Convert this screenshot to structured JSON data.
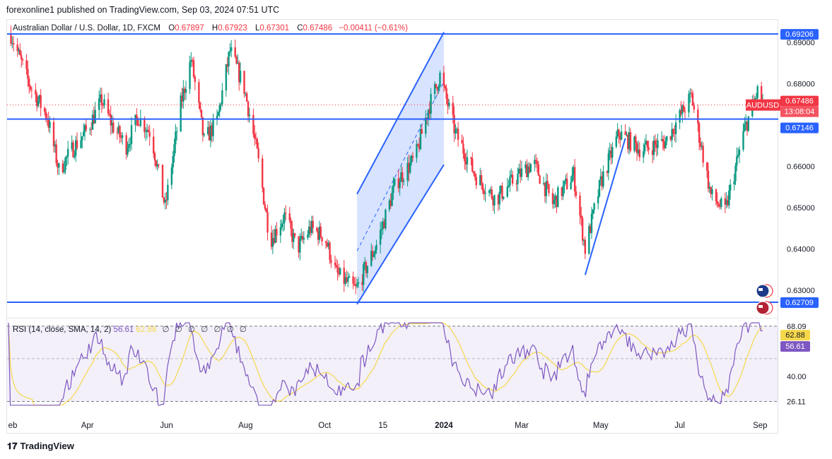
{
  "header": {
    "publish_line": "forexonline1 published on TradingView.com, Sep 03, 2024 07:51 UTC"
  },
  "legend": {
    "symbol": "Australian Dollar / U.S. Dollar, 1D, FXCM",
    "o_label": "O",
    "o_value": "0.67897",
    "h_label": "H",
    "h_value": "0.67923",
    "l_label": "L",
    "l_value": "0.67301",
    "c_label": "C",
    "c_value": "0.67486",
    "change": "−0.00411 (−0.61%)"
  },
  "rsi_legend": {
    "label": "RSI (14, close, SMA, 14, 2)",
    "rsi_value": "56.61",
    "ma_value": "62.88",
    "placeholders": [
      "∅",
      "∅",
      "∅",
      "∅",
      "∅",
      "∅",
      "∅"
    ]
  },
  "price_axis": {
    "ticks": [
      "0.69000",
      "0.68000",
      "0.66000",
      "0.65000",
      "0.64000",
      "0.63000"
    ],
    "labels": [
      {
        "text": "0.69206",
        "value": 0.69206,
        "color": "#2962ff"
      },
      {
        "text": "0.67486",
        "value": 0.67486,
        "color": "#f23645"
      },
      {
        "text": "AUDUSD",
        "value": 0.67486,
        "color": "#f23645"
      },
      {
        "text": "13:08:04",
        "value": 0.67486,
        "color": "#f23645"
      },
      {
        "text": "0.67146",
        "value": 0.67146,
        "color": "#2962ff"
      },
      {
        "text": "0.62709",
        "value": 0.62709,
        "color": "#2962ff"
      }
    ]
  },
  "rsi_axis": {
    "ticks": [
      "68.09",
      "40.00",
      "26.11"
    ],
    "labels": [
      {
        "text": "62.88",
        "value": 62.88,
        "color": "#f6d84b"
      },
      {
        "text": "56.61",
        "value": 56.61,
        "color": "#7e57c2"
      }
    ]
  },
  "time_axis": [
    "eb",
    "Apr",
    "Jun",
    "Aug",
    "Oct",
    "15",
    "2024",
    "Mar",
    "May",
    "Jul",
    "Sep"
  ],
  "footer": {
    "brand": "TradingView"
  },
  "colors": {
    "up": "#089981",
    "down": "#f23645",
    "line": "#2962ff",
    "rsi": "#7e57c2",
    "rsi_ma": "#f6d84b",
    "channel_fill": "#2962ff"
  },
  "chart_data": {
    "type": "candlestick",
    "symbol": "AUDUSD",
    "interval": "1D",
    "ylim": [
      0.6235,
      0.6955
    ],
    "ohlc_last": {
      "open": 0.67897,
      "high": 0.67923,
      "low": 0.67301,
      "close": 0.67486
    },
    "horizontal_levels": [
      0.69206,
      0.67146,
      0.62709
    ],
    "current_price": 0.67486,
    "close_path": [
      [
        "2023-02-01",
        0.692
      ],
      [
        "2023-02-15",
        0.68
      ],
      [
        "2023-03-01",
        0.672
      ],
      [
        "2023-03-10",
        0.659
      ],
      [
        "2023-03-20",
        0.664
      ],
      [
        "2023-04-01",
        0.669
      ],
      [
        "2023-04-12",
        0.676
      ],
      [
        "2023-04-20",
        0.67
      ],
      [
        "2023-05-01",
        0.665
      ],
      [
        "2023-05-10",
        0.672
      ],
      [
        "2023-05-20",
        0.668
      ],
      [
        "2023-05-31",
        0.65
      ],
      [
        "2023-06-12",
        0.675
      ],
      [
        "2023-06-20",
        0.686
      ],
      [
        "2023-06-30",
        0.666
      ],
      [
        "2023-07-10",
        0.671
      ],
      [
        "2023-07-20",
        0.688
      ],
      [
        "2023-07-31",
        0.679
      ],
      [
        "2023-08-10",
        0.663
      ],
      [
        "2023-08-20",
        0.642
      ],
      [
        "2023-08-31",
        0.648
      ],
      [
        "2023-09-10",
        0.64
      ],
      [
        "2023-09-20",
        0.645
      ],
      [
        "2023-10-01",
        0.643
      ],
      [
        "2023-10-10",
        0.634
      ],
      [
        "2023-10-25",
        0.63
      ],
      [
        "2023-11-10",
        0.641
      ],
      [
        "2023-11-25",
        0.656
      ],
      [
        "2023-12-10",
        0.662
      ],
      [
        "2023-12-20",
        0.674
      ],
      [
        "2023-12-29",
        0.682
      ],
      [
        "2024-01-10",
        0.668
      ],
      [
        "2024-01-25",
        0.658
      ],
      [
        "2024-02-10",
        0.652
      ],
      [
        "2024-02-25",
        0.657
      ],
      [
        "2024-03-10",
        0.661
      ],
      [
        "2024-03-25",
        0.651
      ],
      [
        "2024-04-10",
        0.658
      ],
      [
        "2024-04-19",
        0.64
      ],
      [
        "2024-05-01",
        0.656
      ],
      [
        "2024-05-15",
        0.668
      ],
      [
        "2024-06-01",
        0.664
      ],
      [
        "2024-06-20",
        0.666
      ],
      [
        "2024-07-10",
        0.677
      ],
      [
        "2024-07-25",
        0.653
      ],
      [
        "2024-08-05",
        0.649
      ],
      [
        "2024-08-20",
        0.669
      ],
      [
        "2024-08-30",
        0.678
      ],
      [
        "2024-09-03",
        0.675
      ]
    ],
    "trendlines": [
      {
        "from": [
          "2023-10-26",
          0.6266
        ],
        "to": [
          "2024-01-01",
          0.6925
        ]
      },
      {
        "from": [
          "2023-10-26",
          0.6533
        ],
        "to": [
          "2024-01-01",
          0.6685
        ]
      },
      {
        "from": [
          "2024-04-19",
          0.6337
        ],
        "to": [
          "2024-05-20",
          0.6668
        ]
      }
    ],
    "rsi": {
      "period": 14,
      "current": 56.61,
      "ma_current": 62.88,
      "upper": 68.09,
      "lower": 26.11,
      "levels": [
        40.0
      ]
    }
  }
}
